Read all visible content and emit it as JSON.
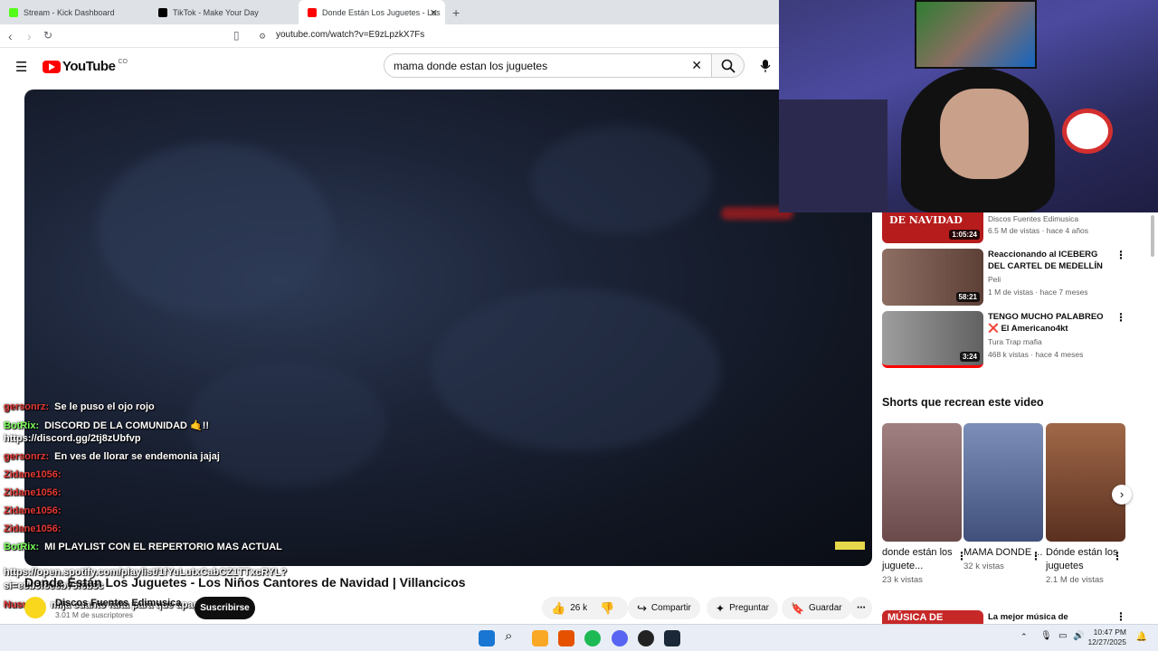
{
  "browser": {
    "tabs": [
      {
        "title": "Stream - Kick Dashboard",
        "favicon_color": "#53fc18"
      },
      {
        "title": "TikTok - Make Your Day",
        "favicon_color": "#000000"
      },
      {
        "title": "Donde Están Los Juguetes - Los",
        "favicon_color": "#ff0000"
      }
    ],
    "new_tab_label": "+",
    "url": "youtube.com/watch?v=E9zLpzkX7Fs"
  },
  "youtube": {
    "logo_text": "YouTube",
    "region": "CO",
    "search_value": "mama donde estan los juguetes"
  },
  "chat": [
    {
      "user": "gersonrz:",
      "text": "Se le puso el ojo rojo",
      "bot": false
    },
    {
      "user": "BotRix:",
      "text": "DISCORD DE LA COMUNIDAD 🤙!!",
      "bot": true
    },
    {
      "user": "",
      "text": "https://discord.gg/2tj8zUbfvp",
      "bot": false
    },
    {
      "user": "gersonrz:",
      "text": "En ves de llorar se endemonia jajaj",
      "bot": false
    },
    {
      "user": "Zidane1056:",
      "text": "",
      "bot": false
    },
    {
      "user": "Zidane1056:",
      "text": "",
      "bot": false
    },
    {
      "user": "Zidane1056:",
      "text": "",
      "bot": false
    },
    {
      "user": "Zidane1056:",
      "text": "",
      "bot": false
    },
    {
      "user": "BotRix:",
      "text": "MI PLAYLIST CON EL REPERTORIO MAS ACTUAL",
      "bot": true
    },
    {
      "user": "",
      "text": "https://open.spotify.com/playlist/1fYuLutxCabCZ1TTxcRYL?",
      "bot": false
    },
    {
      "user": "",
      "text": "si=e8b5f8e8b75f6b3c",
      "bot": false
    },
    {
      "user": "Nusurre:",
      "text": "mija cuanto falta para que apaguense",
      "bot": false
    }
  ],
  "video": {
    "title": "Donde Están Los Juguetes - Los Niños Cantores de Navidad | Villancicos",
    "channel": "Discos Fuentes Edimusica",
    "subscribers": "3.01 M de suscriptores",
    "subscribe_label": "Suscribirse",
    "likes": "26 k",
    "share_label": "Compartir",
    "ask_label": "Preguntar",
    "save_label": "Guardar"
  },
  "related": [
    {
      "title": "",
      "thumb_text": "DE NAVIDAD",
      "channel": "Discos Fuentes Edimusica",
      "meta": "6.5 M de vistas · hace 4 años",
      "duration": "1:05:24",
      "thumb_color": "#b71c1c"
    },
    {
      "title": "Reaccionando al ICEBERG DEL CARTEL DE MEDELLÍN",
      "thumb_text": "",
      "channel": "Peli",
      "meta": "1 M de vistas · hace 7 meses",
      "duration": "58:21",
      "thumb_color": "#6d4c41"
    },
    {
      "title": "TENGO MUCHO PALABREO ❌ El Americano4kt",
      "thumb_text": "",
      "channel": "Tura Trap mafia",
      "meta": "468 k vistas · hace 4 meses",
      "duration": "3:24",
      "thumb_color": "#9e9e9e"
    },
    {
      "title": "La mejor música de Diciembre",
      "thumb_text": "MÚSICA DE",
      "channel": "",
      "meta": "",
      "duration": "",
      "thumb_color": "#c62828"
    }
  ],
  "shorts": {
    "heading": "Shorts que recrean este video",
    "items": [
      {
        "title": "donde están los juguete...",
        "views": "23 k vistas",
        "thumb_color": "#8a6a6a"
      },
      {
        "title": "MAMA DONDE ...",
        "views": "32 k vistas",
        "thumb_color": "#5a6e9a"
      },
      {
        "title": "Dónde están los juguetes",
        "views": "2.1 M de vistas",
        "thumb_color": "#7a5040"
      }
    ]
  },
  "taskbar": {
    "time": "10:47 PM",
    "date": "12/27/2025"
  }
}
